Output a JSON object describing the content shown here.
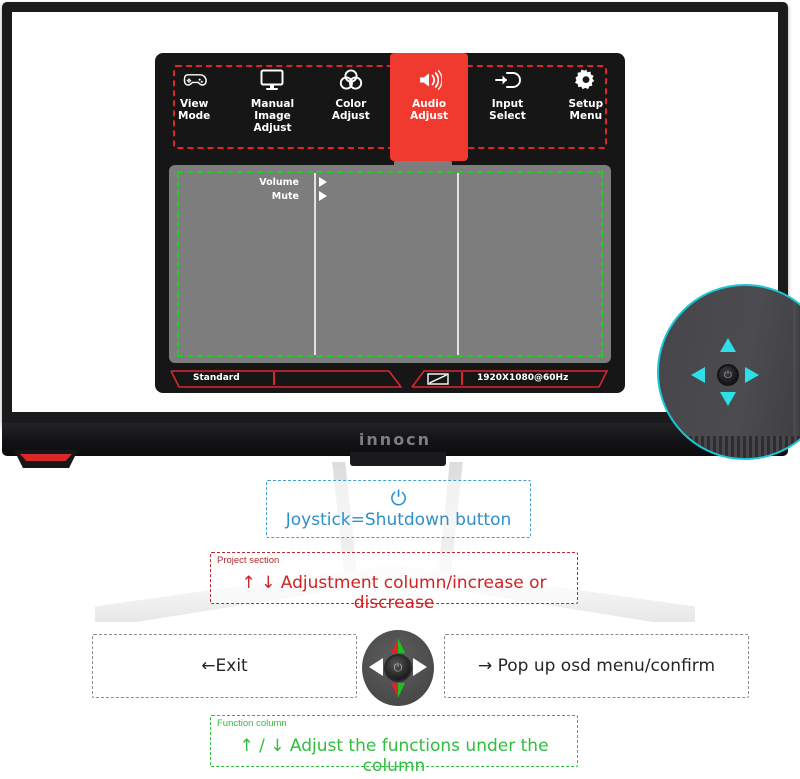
{
  "monitor": {
    "brand_logo": "innocn",
    "screen_color": "#fefefe",
    "bezel_color": "#1b1b1d",
    "accent_red": "#d7282c"
  },
  "osd": {
    "tabs": [
      {
        "icon": "gamepad-icon",
        "line1": "View",
        "line2": "Mode",
        "active": false
      },
      {
        "icon": "monitor-icon",
        "line1": "Manual Image",
        "line2": "Adjust",
        "active": false
      },
      {
        "icon": "color-venn-icon",
        "line1": "Color",
        "line2": "Adjust",
        "active": false
      },
      {
        "icon": "speaker-icon",
        "line1": "Audio",
        "line2": "Adjust",
        "active": true
      },
      {
        "icon": "input-arrow-icon",
        "line1": "Input",
        "line2": "Select",
        "active": false
      },
      {
        "icon": "gear-icon",
        "line1": "Setup",
        "line2": "Menu",
        "active": false
      }
    ],
    "active_tab": "Audio Adjust",
    "highlight_color": "#f0392f",
    "menu_items": [
      {
        "label": "Volume",
        "submenu_arrow": true
      },
      {
        "label": "Mute",
        "submenu_arrow": true
      }
    ],
    "status_bar": {
      "preset": "Standard",
      "source_icon": "hdmi-display-icon",
      "resolution": "1920X1080@60Hz"
    },
    "annotation_boxes": {
      "tabs_box_color": "#e0232b",
      "body_box_color": "#1fcc1f"
    }
  },
  "magnifier": {
    "ring_color": "#19c6d4",
    "joystick_center_icon": "power-icon",
    "directions": [
      "up",
      "down",
      "left",
      "right"
    ],
    "arrow_color": "#2de0e8"
  },
  "callouts": {
    "shutdown": {
      "icon": "power-icon",
      "text": "Joystick=Shutdown button",
      "color": "#2d8fcc",
      "border_color": "#3f9fd6"
    },
    "project": {
      "tag": "Project section",
      "text": "↑ ↓ Adjustment column/increase or discrease",
      "color": "#cf2326",
      "border_color": "#c0282c"
    },
    "exit": {
      "text": "←Exit",
      "border_color": "#8a8a8a"
    },
    "popup": {
      "text": "→ Pop up osd menu/confirm",
      "border_color": "#8a8a8a"
    },
    "function": {
      "tag": "Function column",
      "text": "↑ / ↓ Adjust the functions under the column",
      "color": "#2fbe3d",
      "border_color": "#2ebd3a"
    }
  },
  "joystick_diagram": {
    "center_icon": "power-icon",
    "up_colors": [
      "#d8262c",
      "#1fbe22"
    ],
    "down_colors": [
      "#d8262c",
      "#1fbe22"
    ],
    "left_color": "#ffffff",
    "right_color": "#ffffff"
  }
}
